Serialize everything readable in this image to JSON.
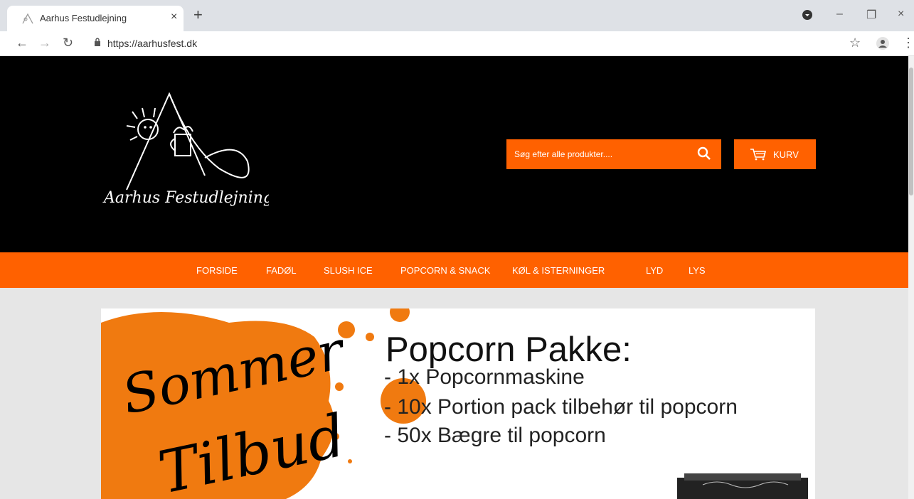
{
  "browser": {
    "tab_title": "Aarhus Festudlejning",
    "tab_close": "×",
    "new_tab": "+",
    "url": "https://aarhusfest.dk",
    "window_controls": [
      "–",
      "❐",
      "×"
    ]
  },
  "site": {
    "logo_text": "Aarhus Festudlejning",
    "search_placeholder": "Søg efter alle produkter....",
    "cart_label": "KURV",
    "colors": {
      "accent": "#ff6100",
      "header_bg": "#000000",
      "page_bg": "#e6e6e6"
    }
  },
  "nav": {
    "items": [
      "FORSIDE",
      "FADØL",
      "SLUSH ICE",
      "POPCORN & SNACK",
      "KØL & ISTERNINGER",
      "LYD",
      "LYS"
    ]
  },
  "banner": {
    "script_word_1": "Sommer",
    "script_word_2": "Tilbud",
    "headline": "Popcorn Pakke:",
    "lines": [
      "- 1x Popcornmaskine",
      "- 10x Portion pack tilbehør til popcorn",
      "- 50x Bægre til popcorn"
    ]
  }
}
